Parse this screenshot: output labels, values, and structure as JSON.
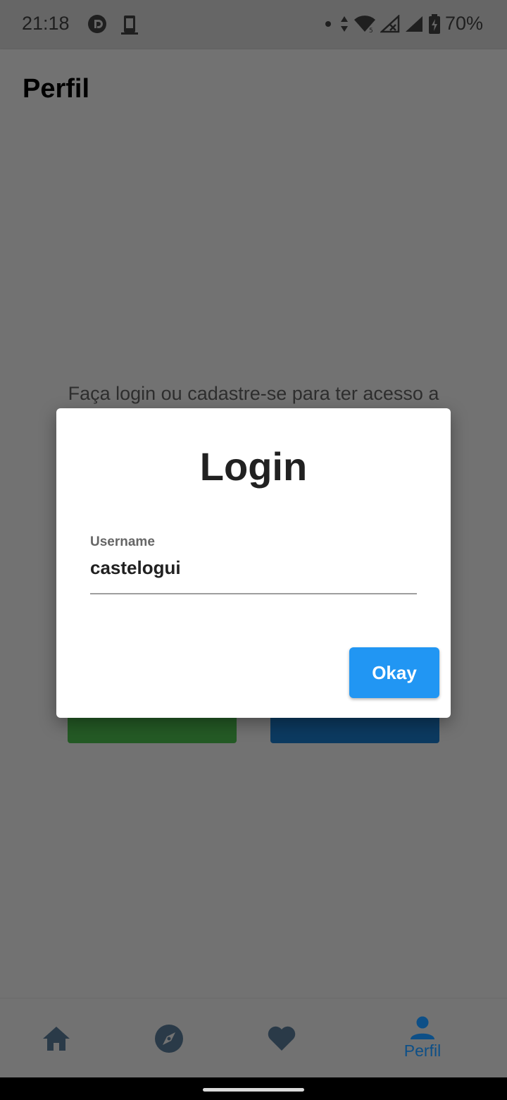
{
  "status_bar": {
    "time": "21:18",
    "battery": "70%",
    "icons": [
      "pocketcasts-icon",
      "device-icon",
      "dot-icon",
      "data-arrows-icon",
      "wifi-icon",
      "signal-x-icon",
      "signal-icon",
      "battery-charging-icon"
    ]
  },
  "app_bar": {
    "title": "Perfil"
  },
  "content": {
    "prompt": "Faça login ou cadastre-se para ter acesso a"
  },
  "dialog": {
    "title": "Login",
    "username_label": "Username",
    "username_value": "castelogui",
    "ok_label": "Okay"
  },
  "bottom_nav": {
    "items": [
      {
        "icon": "home-icon",
        "label": ""
      },
      {
        "icon": "compass-icon",
        "label": ""
      },
      {
        "icon": "heart-icon",
        "label": ""
      },
      {
        "icon": "person-icon",
        "label": "Perfil"
      }
    ]
  },
  "colors": {
    "accent": "#2196f3",
    "nav_active": "#0d4f87",
    "scrim": "#727272"
  }
}
